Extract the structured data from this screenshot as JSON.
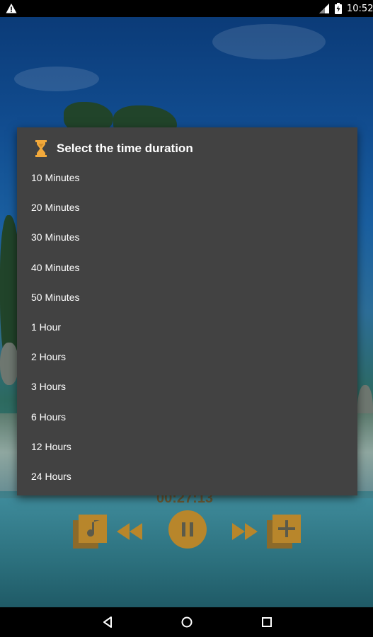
{
  "status_bar": {
    "time": "10:52",
    "icons": [
      "warning-icon",
      "signal-icon",
      "battery-icon"
    ]
  },
  "player": {
    "time": "00:27:13",
    "accent_color": "#b8862b",
    "controls": [
      "playlist-music-icon",
      "rewind-icon",
      "pause-icon",
      "fast-forward-icon",
      "playlist-add-icon"
    ]
  },
  "dialog": {
    "title": "Select the time duration",
    "icon": "hourglass-icon",
    "icon_color": "#f2a93b",
    "background": "#424242",
    "options": [
      {
        "label": "10 Minutes"
      },
      {
        "label": "20 Minutes"
      },
      {
        "label": "30 Minutes"
      },
      {
        "label": "40 Minutes"
      },
      {
        "label": "50 Minutes"
      },
      {
        "label": "1 Hour"
      },
      {
        "label": "2 Hours"
      },
      {
        "label": "3 Hours"
      },
      {
        "label": "6 Hours"
      },
      {
        "label": "12 Hours"
      },
      {
        "label": "24 Hours"
      }
    ]
  },
  "nav_bar": {
    "buttons": [
      "back-icon",
      "home-icon",
      "recents-icon"
    ]
  }
}
